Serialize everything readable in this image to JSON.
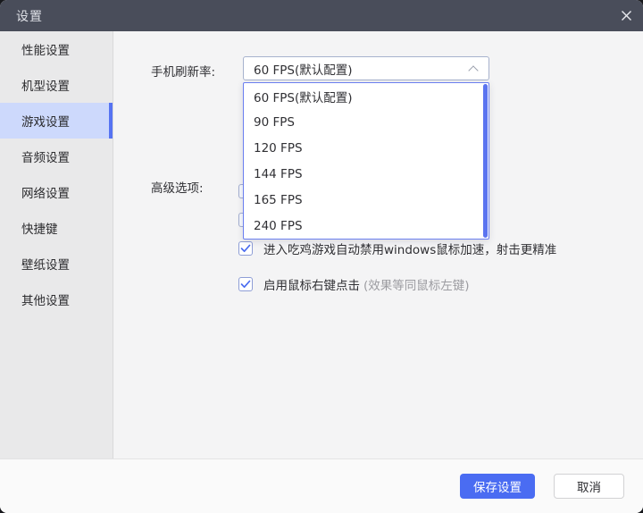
{
  "titlebar": {
    "title": "设置",
    "close_icon": "x"
  },
  "sidebar": {
    "items": [
      {
        "label": "性能设置",
        "selected": false
      },
      {
        "label": "机型设置",
        "selected": false
      },
      {
        "label": "游戏设置",
        "selected": true
      },
      {
        "label": "音频设置",
        "selected": false
      },
      {
        "label": "网络设置",
        "selected": false
      },
      {
        "label": "快捷键",
        "selected": false
      },
      {
        "label": "壁纸设置",
        "selected": false
      },
      {
        "label": "其他设置",
        "selected": false
      }
    ]
  },
  "content": {
    "refresh_rate_label": "手机刷新率:",
    "refresh_rate_value": "60 FPS(默认配置)",
    "dropdown_options": [
      "60 FPS(默认配置)",
      "90 FPS",
      "120 FPS",
      "144 FPS",
      "165 FPS",
      "240 FPS"
    ],
    "advanced_label": "高级选项:",
    "checkboxes": [
      {
        "label": "进入吃鸡游戏自动禁用windows鼠标加速，射击更精准",
        "note": "",
        "checked": true
      },
      {
        "label": "启用鼠标右键点击",
        "note": "(效果等同鼠标左键)",
        "checked": true
      }
    ]
  },
  "footer": {
    "save_label": "保存设置",
    "cancel_label": "取消"
  },
  "colors": {
    "titlebar_bg": "#494d5a",
    "sidebar_bg": "#e9e9ea",
    "content_bg": "#f4f4f5",
    "selected_item_bg": "#cdd9fc",
    "accent_bar": "#5673f2",
    "dropdown_border": "#6b7ff0",
    "scrollbar_thumb": "#5b74f0",
    "save_button_bg": "#4a6cf2",
    "check_mark": "#4a6cf0"
  }
}
